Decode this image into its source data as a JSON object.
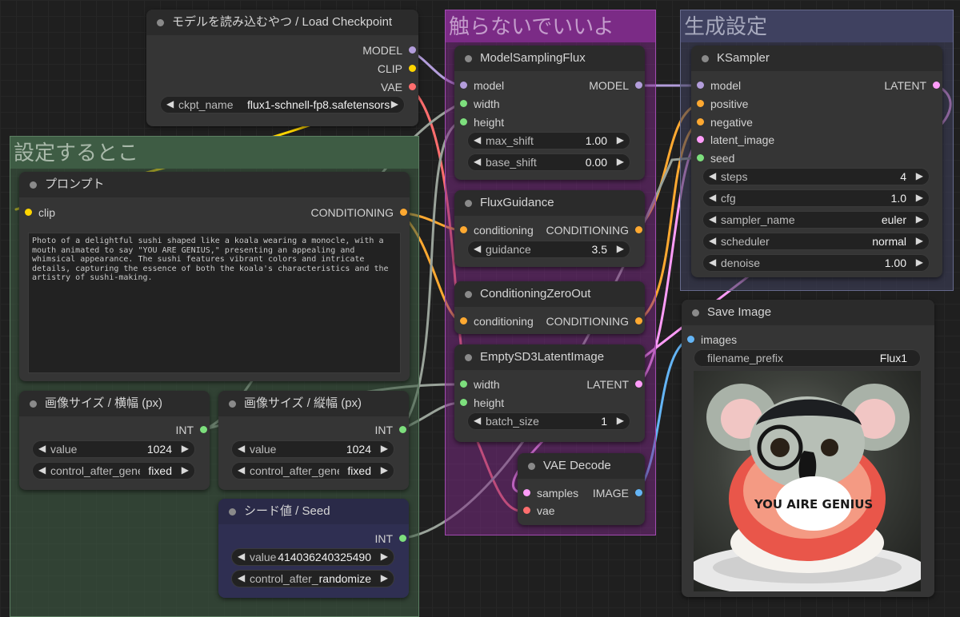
{
  "colors": {
    "model": "#b39ddb",
    "clip": "#ffd500",
    "vae": "#ff6e6e",
    "conditioning": "#ffa931",
    "latent": "#ff9cf9",
    "int": "#7ddf7d",
    "image": "#64b5f6",
    "group_settings": "#3f5e45",
    "group_donttouch": "#7e2a88",
    "group_gen": "#3d3f5a"
  },
  "groups": {
    "settings": {
      "title": "設定するとこ"
    },
    "donttouch": {
      "title": "触らないでいいよ"
    },
    "generation": {
      "title": "生成設定"
    }
  },
  "load_checkpoint": {
    "title": "モデルを読み込むやつ / Load Checkpoint",
    "outputs": [
      "MODEL",
      "CLIP",
      "VAE"
    ],
    "ckpt_label": "ckpt_name",
    "ckpt_value": "flux1-schnell-fp8.safetensors"
  },
  "prompt": {
    "title": "プロンプト",
    "input": "clip",
    "output": "CONDITIONING",
    "text": "Photo of a delightful sushi shaped like a koala wearing a monocle, with a mouth animated to say \"YOU ARE GENIUS,\" presenting an appealing and whimsical appearance. The sushi features vibrant colors and intricate details, capturing the essence of both the koala's characteristics and the artistry of sushi-making."
  },
  "width_node": {
    "title": "画像サイズ / 横幅 (px)",
    "output": "INT",
    "value_label": "value",
    "value": "1024",
    "control_label": "control_after_generate",
    "control_value": "fixed"
  },
  "height_node": {
    "title": "画像サイズ / 縦幅 (px)",
    "output": "INT",
    "value_label": "value",
    "value": "1024",
    "control_label": "control_after_generate",
    "control_value": "fixed"
  },
  "seed_node": {
    "title": "シード値 / Seed",
    "output": "INT",
    "value_label": "value",
    "value": "414036240325490",
    "control_label": "control_after_generate",
    "control_value": "randomize"
  },
  "model_sampling": {
    "title": "ModelSamplingFlux",
    "inputs": [
      "model",
      "width",
      "height"
    ],
    "output": "MODEL",
    "max_shift_label": "max_shift",
    "max_shift": "1.00",
    "base_shift_label": "base_shift",
    "base_shift": "0.00"
  },
  "flux_guidance": {
    "title": "FluxGuidance",
    "input": "conditioning",
    "output": "CONDITIONING",
    "guidance_label": "guidance",
    "guidance": "3.5"
  },
  "cond_zero": {
    "title": "ConditioningZeroOut",
    "input": "conditioning",
    "output": "CONDITIONING"
  },
  "empty_latent": {
    "title": "EmptySD3LatentImage",
    "inputs": [
      "width",
      "height"
    ],
    "output": "LATENT",
    "batch_label": "batch_size",
    "batch_value": "1"
  },
  "vae_decode": {
    "title": "VAE Decode",
    "inputs": [
      "samples",
      "vae"
    ],
    "output": "IMAGE"
  },
  "ksampler": {
    "title": "KSampler",
    "inputs": [
      "model",
      "positive",
      "negative",
      "latent_image",
      "seed"
    ],
    "output": "LATENT",
    "widgets": [
      {
        "label": "steps",
        "value": "4"
      },
      {
        "label": "cfg",
        "value": "1.0"
      },
      {
        "label": "sampler_name",
        "value": "euler"
      },
      {
        "label": "scheduler",
        "value": "normal"
      },
      {
        "label": "denoise",
        "value": "1.00"
      }
    ]
  },
  "save_image": {
    "title": "Save Image",
    "input": "images",
    "prefix_label": "filename_prefix",
    "prefix_value": "Flux1",
    "preview_text": "YOU AIRE GENIUS"
  }
}
